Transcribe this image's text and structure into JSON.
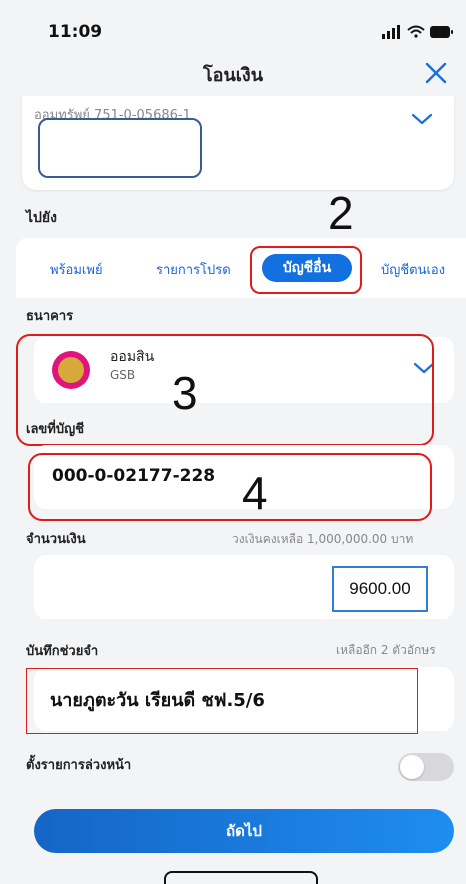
{
  "status_bar": {
    "time": "11:09"
  },
  "header": {
    "title": "โอนเงิน"
  },
  "source_account": {
    "label": "ออมทรัพย์ 751-0-05686-1"
  },
  "to_label": "ไปยัง",
  "annotations": {
    "n2": "2",
    "n3": "3",
    "n4": "4"
  },
  "tabs": [
    {
      "label": "พร้อมเพย์"
    },
    {
      "label": "รายการโปรด"
    },
    {
      "label": "บัญชีอื่น",
      "active": true
    },
    {
      "label": "บัญชีตนเอง"
    }
  ],
  "bank": {
    "section_label": "ธนาคาร",
    "name": "ออมสิน",
    "code": "GSB"
  },
  "account": {
    "section_label": "เลขที่บัญชี",
    "value": "000-0-02177-228"
  },
  "amount": {
    "section_label": "จำนวนเงิน",
    "limit_text": "วงเงินคงเหลือ 1,000,000.00 บาท",
    "value": "9600.00"
  },
  "memo": {
    "section_label": "บันทึกช่วยจำ",
    "remaining_text": "เหลืออีก 2 ตัวอักษร",
    "value": "นายภูตะวัน เรียนดี ชฟ.5/6"
  },
  "schedule": {
    "label": "ตั้งรายการล่วงหน้า",
    "enabled": false
  },
  "next_button": {
    "label": "ถัดไป"
  },
  "colors": {
    "accent": "#1270e0",
    "annotation_red": "#e01b1b",
    "annotation_blue": "#3a5d8f"
  }
}
